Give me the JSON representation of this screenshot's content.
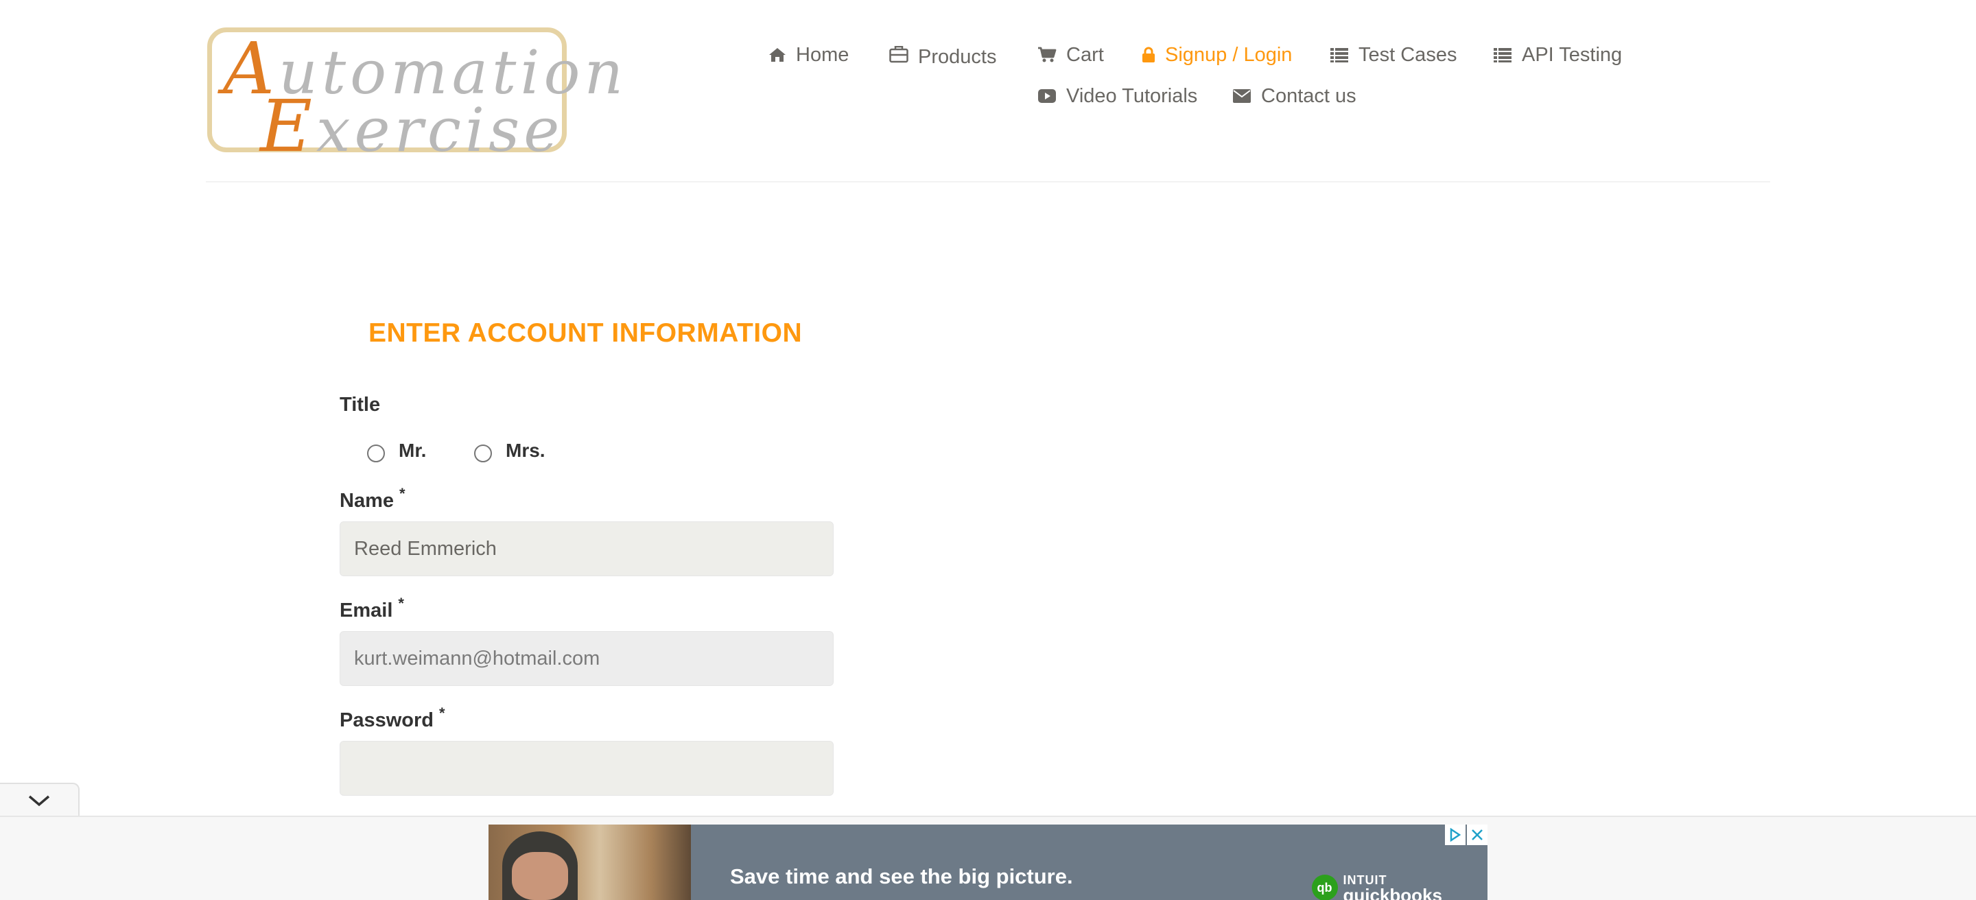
{
  "logo": {
    "line1_cap": "A",
    "line1_rest": "utomation",
    "line2_cap": "E",
    "line2_rest": "xercise"
  },
  "nav": {
    "items": [
      {
        "label": "Home",
        "icon": "home-icon"
      },
      {
        "label": "Products",
        "icon": "briefcase-icon"
      },
      {
        "label": "Cart",
        "icon": "cart-icon"
      },
      {
        "label": "Signup / Login",
        "icon": "lock-icon",
        "active": true
      },
      {
        "label": "Test Cases",
        "icon": "list-icon"
      },
      {
        "label": "API Testing",
        "icon": "list-icon"
      },
      {
        "label": "Video Tutorials",
        "icon": "youtube-play-icon"
      },
      {
        "label": "Contact us",
        "icon": "envelope-icon"
      }
    ]
  },
  "form": {
    "heading": "ENTER ACCOUNT INFORMATION",
    "title_label": "Title",
    "title_options": [
      "Mr.",
      "Mrs."
    ],
    "name_label": "Name",
    "name_value": "Reed Emmerich",
    "email_label": "Email",
    "email_value": "kurt.weimann@hotmail.com",
    "password_label": "Password",
    "password_value": "",
    "required_mark": "*"
  },
  "ad": {
    "headline": "Save time and see the big picture.",
    "brand_small": "INTUIT",
    "brand_large": "quickbooks",
    "brand_mark": "qb",
    "icons": [
      "adchoices-icon",
      "close-icon"
    ]
  },
  "colors": {
    "accent": "#fe980f",
    "text": "#696763",
    "label": "#333333",
    "input_bg": "#eeeeea",
    "ad_bg": "#6d7a87"
  }
}
